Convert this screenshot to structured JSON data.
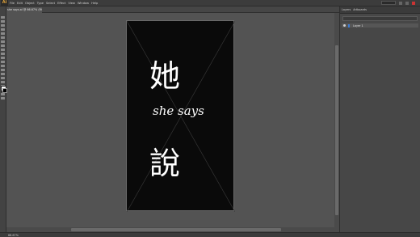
{
  "menu": {
    "logo": "Ai",
    "items": [
      "File",
      "Edit",
      "Object",
      "Type",
      "Select",
      "Effect",
      "View",
      "Window",
      "Help"
    ]
  },
  "document": {
    "tab_label": "she says.ai @ 66.67% (RGB/Preview)"
  },
  "panel": {
    "tabs": [
      "Layers",
      "Artboards"
    ],
    "layer_name": "Layer 1"
  },
  "artboard": {
    "char_top": "她",
    "subtitle": "she says",
    "char_bottom": "說",
    "background": "#0a0a0a",
    "text_color": "#ffffff"
  },
  "status": {
    "zoom": "66.67%"
  }
}
